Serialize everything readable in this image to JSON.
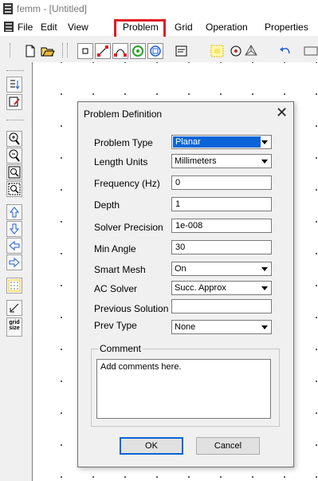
{
  "window": {
    "title": "femm - [Untitled]"
  },
  "menu": {
    "items": [
      "File",
      "Edit",
      "View",
      "Problem",
      "Grid",
      "Operation",
      "Properties"
    ],
    "highlighted": "Problem",
    "highlight_color": "#e01b24"
  },
  "toolbar_icons": [
    "new-icon",
    "open-icon",
    "node-icon",
    "segment-icon",
    "arc-icon",
    "block-label-icon",
    "group-icon",
    "properties-icon",
    "select-window-icon",
    "circle-icon",
    "mesh-icon",
    "undo-icon"
  ],
  "left_toolbar_icons": [
    "show-names-icon",
    "edit-icon",
    "zoom-in-icon",
    "zoom-out-icon",
    "zoom-natural-icon",
    "zoom-window-icon",
    "pan-up-icon",
    "pan-down-icon",
    "pan-left-icon",
    "pan-right-icon",
    "show-grid-icon",
    "snap-grid-icon",
    "grid-size-icon"
  ],
  "left_toolbar": {
    "grid_size_label_1": "grid",
    "grid_size_label_2": "size"
  },
  "dialog": {
    "title": "Problem Definition",
    "close_glyph": "✕",
    "fields": {
      "problem_type": {
        "label": "Problem Type",
        "value": "Planar"
      },
      "length_units": {
        "label": "Length Units",
        "value": "Millimeters"
      },
      "frequency": {
        "label": "Frequency (Hz)",
        "value": "0"
      },
      "depth": {
        "label": "Depth",
        "value": "1"
      },
      "solver_precision": {
        "label": "Solver Precision",
        "value": "1e-008"
      },
      "min_angle": {
        "label": "Min Angle",
        "value": "30"
      },
      "smart_mesh": {
        "label": "Smart Mesh",
        "value": "On"
      },
      "ac_solver": {
        "label": "AC Solver",
        "value": "Succ. Approx"
      },
      "previous_solution": {
        "label": "Previous Solution",
        "value": ""
      },
      "prev_type": {
        "label": "Prev Type",
        "value": "None"
      }
    },
    "comment": {
      "legend": "Comment",
      "value": "Add comments here."
    },
    "buttons": {
      "ok": "OK",
      "cancel": "Cancel"
    }
  },
  "colors": {
    "selection": "#0a64d8",
    "canvas": "#ffffff",
    "chrome": "#f0f0f0"
  }
}
